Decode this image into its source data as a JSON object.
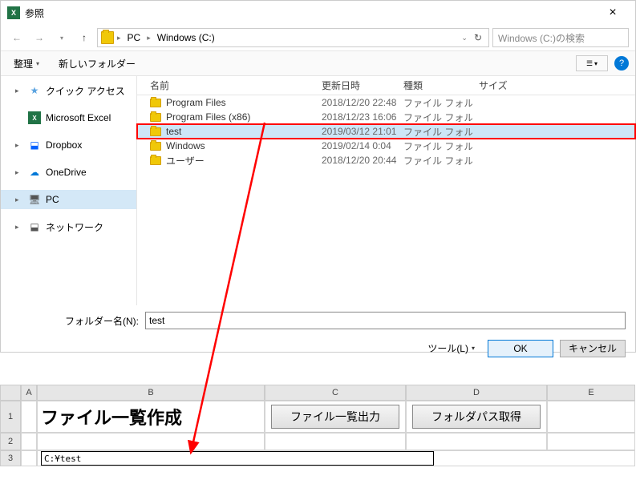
{
  "dialog": {
    "title": "参照",
    "breadcrumb": {
      "pc": "PC",
      "drive": "Windows (C:)"
    },
    "search_placeholder": "Windows (C:)の検索",
    "toolbar": {
      "organize": "整理",
      "new_folder": "新しいフォルダー"
    },
    "sidebar": [
      {
        "label": "クイック アクセス",
        "icon": "star"
      },
      {
        "label": "Microsoft Excel",
        "icon": "excel"
      },
      {
        "label": "Dropbox",
        "icon": "dropbox"
      },
      {
        "label": "OneDrive",
        "icon": "onedrive"
      },
      {
        "label": "PC",
        "icon": "pc",
        "selected": true
      },
      {
        "label": "ネットワーク",
        "icon": "net"
      }
    ],
    "columns": {
      "name": "名前",
      "date": "更新日時",
      "type": "種類",
      "size": "サイズ"
    },
    "rows": [
      {
        "name": "Program Files",
        "date": "2018/12/20 22:48",
        "type": "ファイル フォルダー"
      },
      {
        "name": "Program Files (x86)",
        "date": "2018/12/23 16:06",
        "type": "ファイル フォルダー"
      },
      {
        "name": "test",
        "date": "2019/03/12 21:01",
        "type": "ファイル フォルダー",
        "selected": true,
        "highlight": true
      },
      {
        "name": "Windows",
        "date": "2019/02/14 0:04",
        "type": "ファイル フォルダー"
      },
      {
        "name": "ユーザー",
        "date": "2018/12/20 20:44",
        "type": "ファイル フォルダー"
      }
    ],
    "folder_label": "フォルダー名(N):",
    "folder_value": "test",
    "tool_label": "ツール(L)",
    "ok": "OK",
    "cancel": "キャンセル"
  },
  "sheet": {
    "cols": [
      "A",
      "B",
      "C",
      "D",
      "E"
    ],
    "rows": [
      "1",
      "2",
      "3"
    ],
    "title": "ファイル一覧作成",
    "btn1": "ファイル一覧出力",
    "btn2": "フォルダパス取得",
    "path": "C:¥test"
  }
}
